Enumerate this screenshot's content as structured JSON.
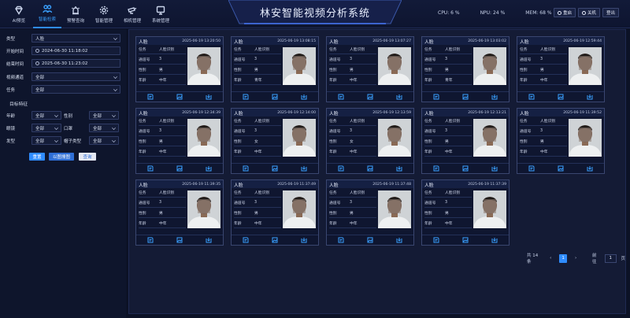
{
  "header": {
    "title": "林安智能视频分析系统",
    "nav": [
      {
        "label": "AI预览",
        "icon": "diamond-icon"
      },
      {
        "label": "智能检索",
        "icon": "search-people-icon",
        "active": true
      },
      {
        "label": "预警查询",
        "icon": "alarm-icon"
      },
      {
        "label": "智能管理",
        "icon": "gear-icon"
      },
      {
        "label": "相机管理",
        "icon": "camera-icon"
      },
      {
        "label": "系统管理",
        "icon": "system-icon"
      }
    ],
    "stats": {
      "cpu": "CPU: 6 %",
      "npu": "NPU: 24 %",
      "mem": "MEM: 68 %"
    },
    "buttons": {
      "restart": "重启",
      "shutdown": "关机",
      "logout": "登出"
    }
  },
  "filters": {
    "type_label": "类型",
    "type_value": "人脸",
    "start_label": "开始时间",
    "start_value": "2024-06-30 11:18:02",
    "end_label": "结束时间",
    "end_value": "2025-06-30 11:23:02",
    "channel_label": "视频通道",
    "channel_value": "全部",
    "task_label": "任务",
    "task_value": "全部",
    "section_title": "目标特征",
    "age_label": "年龄",
    "age_value": "全部",
    "gender_label": "性别",
    "gender_value": "全部",
    "glasses_label": "眼镜",
    "glasses_value": "全部",
    "mask_label": "口罩",
    "mask_value": "全部",
    "hair_label": "发型",
    "hair_value": "全部",
    "hat_label": "帽子类型",
    "hat_value": "全部",
    "reset_button": "重置",
    "image_search_button": "以图搜图",
    "query_button": "查询"
  },
  "row_labels": {
    "task": "任务",
    "channel": "通道号",
    "gender": "性别",
    "age": "年龄"
  },
  "cards": [
    {
      "type": "人脸",
      "time": "2025-06-19 13:20:50",
      "task": "人脸识别",
      "channel": "3",
      "gender": "男",
      "age": "中年"
    },
    {
      "type": "人脸",
      "time": "2025-06-19 13:08:15",
      "task": "人脸识别",
      "channel": "3",
      "gender": "男",
      "age": "青年"
    },
    {
      "type": "人脸",
      "time": "2025-06-19 13:07:27",
      "task": "人脸识别",
      "channel": "3",
      "gender": "男",
      "age": "中年"
    },
    {
      "type": "人脸",
      "time": "2025-06-19 13:03:02",
      "task": "人脸识别",
      "channel": "3",
      "gender": "男",
      "age": "青年"
    },
    {
      "type": "人脸",
      "time": "2025-06-19 12:59:44",
      "task": "人脸识别",
      "channel": "3",
      "gender": "男",
      "age": "中年"
    },
    {
      "type": "人脸",
      "time": "2025-06-19 12:34:39",
      "task": "人脸识别",
      "channel": "3",
      "gender": "男",
      "age": "中年"
    },
    {
      "type": "人脸",
      "time": "2025-06-19 12:14:00",
      "task": "人脸识别",
      "channel": "3",
      "gender": "女",
      "age": "中年"
    },
    {
      "type": "人脸",
      "time": "2025-06-19 12:13:59",
      "task": "人脸识别",
      "channel": "3",
      "gender": "女",
      "age": "中年"
    },
    {
      "type": "人脸",
      "time": "2025-06-19 12:13:21",
      "task": "人脸识别",
      "channel": "3",
      "gender": "男",
      "age": "中年"
    },
    {
      "type": "人脸",
      "time": "2025-06-19 11:39:52",
      "task": "人脸识别",
      "channel": "3",
      "gender": "男",
      "age": "中年"
    },
    {
      "type": "人脸",
      "time": "2025-06-19 11:39:35",
      "task": "人脸识别",
      "channel": "3",
      "gender": "男",
      "age": "中年"
    },
    {
      "type": "人脸",
      "time": "2025-06-19 11:37:49",
      "task": "人脸识别",
      "channel": "3",
      "gender": "男",
      "age": "中年"
    },
    {
      "type": "人脸",
      "time": "2025-06-19 11:37:48",
      "task": "人脸识别",
      "channel": "3",
      "gender": "男",
      "age": "中年"
    },
    {
      "type": "人脸",
      "time": "2025-06-19 11:37:39",
      "task": "人脸识别",
      "channel": "3",
      "gender": "男",
      "age": "中年"
    }
  ],
  "pagination": {
    "total": "共 14 条",
    "current_page": "1",
    "goto_label": "前往",
    "goto_value": "1",
    "page_unit": "页"
  },
  "colors": {
    "accent": "#2f8cff",
    "background": "#0c1226",
    "panel": "#141b35"
  }
}
